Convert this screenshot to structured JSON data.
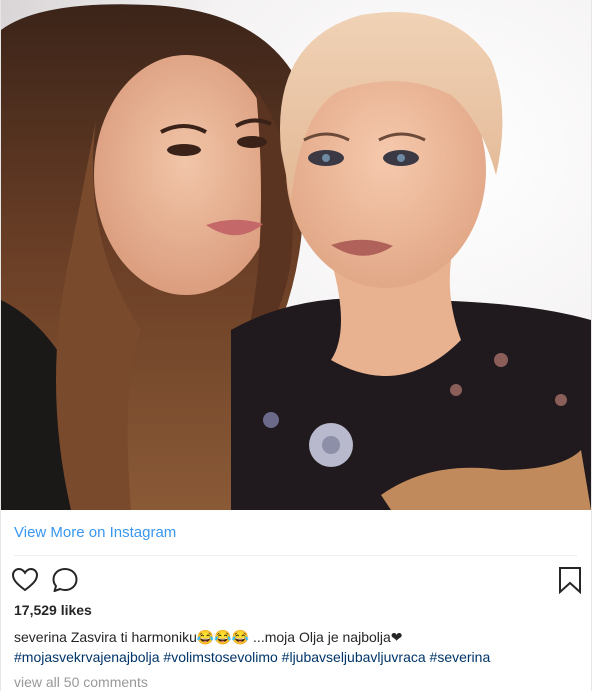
{
  "post": {
    "view_more_label": "View More on Instagram",
    "likes_text": "17,529 likes",
    "username": "severina",
    "caption_text": "Zasvira ti harmoniku😂😂😂 ...moja Olja je najbolja❤",
    "hashtags": "#mojasvekrvajenajbolja #volimstosevolimo #ljubavseljubavljuvraca #severina",
    "view_comments_label": "view all 50 comments"
  },
  "icons": {
    "like": "heart-icon",
    "comment": "comment-icon",
    "save": "bookmark-icon"
  },
  "colors": {
    "link": "#3897f0",
    "hashtag": "#003569",
    "muted": "#999999",
    "text": "#262626"
  }
}
